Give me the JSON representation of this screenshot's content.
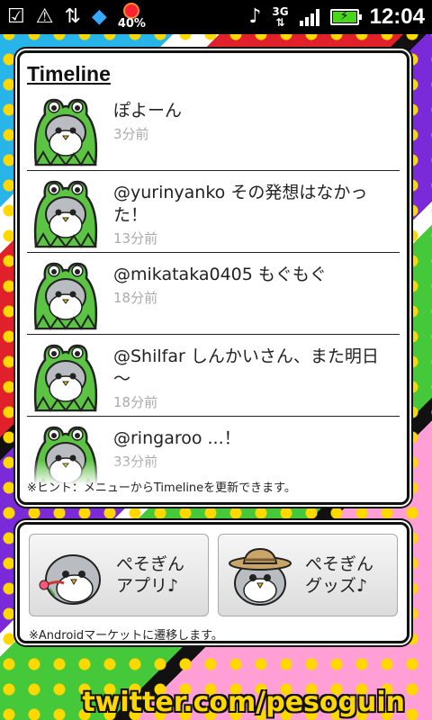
{
  "status_bar": {
    "icons_left": [
      "download-done-icon",
      "warning-icon",
      "usb-icon",
      "app-icon",
      "weather-icon"
    ],
    "weather_percent": "40%",
    "icons_right": [
      "vibrate-icon",
      "3g-data-icon",
      "signal-icon",
      "battery-charging-icon"
    ],
    "network": "3G",
    "time": "12:04"
  },
  "timeline": {
    "title": "Timeline",
    "tweets": [
      {
        "text": "ぽよーん",
        "time": "3分前"
      },
      {
        "text": "@yurinyanko その発想はなかった！",
        "time": "13分前"
      },
      {
        "text": "@mikataka0405 もぐもぐ",
        "time": "18分前"
      },
      {
        "text": "@Shilfar しんかいさん、また明日～",
        "time": "18分前"
      },
      {
        "text": "@ringaroo ...！",
        "time": "33分前"
      }
    ],
    "hint": "※ヒント：メニューからTimelineを更新できます。"
  },
  "apps": {
    "buttons": [
      {
        "label_line1": "ぺそぎん",
        "label_line2": "アプリ♪"
      },
      {
        "label_line1": "ぺそぎん",
        "label_line2": "グッズ♪"
      }
    ],
    "note": "※Androidマーケットに遷移します。"
  },
  "footer": {
    "handle": "twitter.com/pesoguin"
  },
  "colors": {
    "frog_green": "#5bc442",
    "clock_text": "#ffffff",
    "handle_yellow": "#ffd700",
    "time_gray": "#aaaaaa"
  }
}
